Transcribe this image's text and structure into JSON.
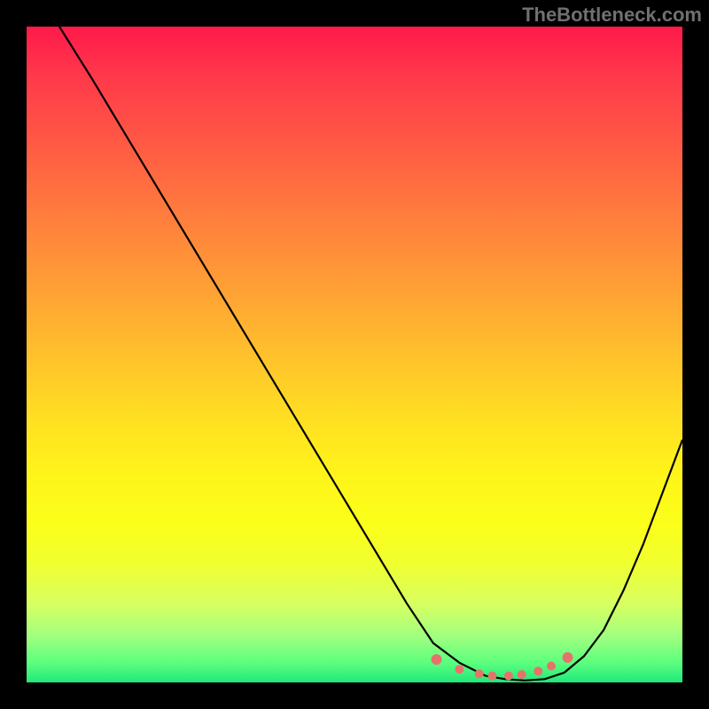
{
  "watermark": "TheBottleneck.com",
  "chart_data": {
    "type": "line",
    "title": "",
    "xlabel": "",
    "ylabel": "",
    "xlim": [
      0,
      100
    ],
    "ylim": [
      0,
      100
    ],
    "series": [
      {
        "name": "curve",
        "x": [
          5,
          10,
          16,
          22,
          28,
          34,
          40,
          46,
          52,
          58,
          62,
          66,
          70,
          73,
          76,
          79,
          82,
          85,
          88,
          91,
          94,
          97,
          100
        ],
        "y": [
          100,
          92,
          82,
          72,
          62,
          52,
          42,
          32,
          22,
          12,
          6,
          3,
          1,
          0.5,
          0.3,
          0.5,
          1.5,
          4,
          8,
          14,
          21,
          29,
          37
        ]
      }
    ],
    "markers": {
      "x": [
        62.5,
        66,
        69,
        71,
        73.5,
        75.5,
        78,
        80,
        82.5
      ],
      "y": [
        3.5,
        2,
        1.3,
        1,
        1,
        1.2,
        1.7,
        2.5,
        3.8
      ]
    },
    "gradient_stops": [
      {
        "pos": 0,
        "color": "#ff1a4a"
      },
      {
        "pos": 50,
        "color": "#ffc726"
      },
      {
        "pos": 85,
        "color": "#f5ff2a"
      },
      {
        "pos": 100,
        "color": "#20e87a"
      }
    ]
  }
}
